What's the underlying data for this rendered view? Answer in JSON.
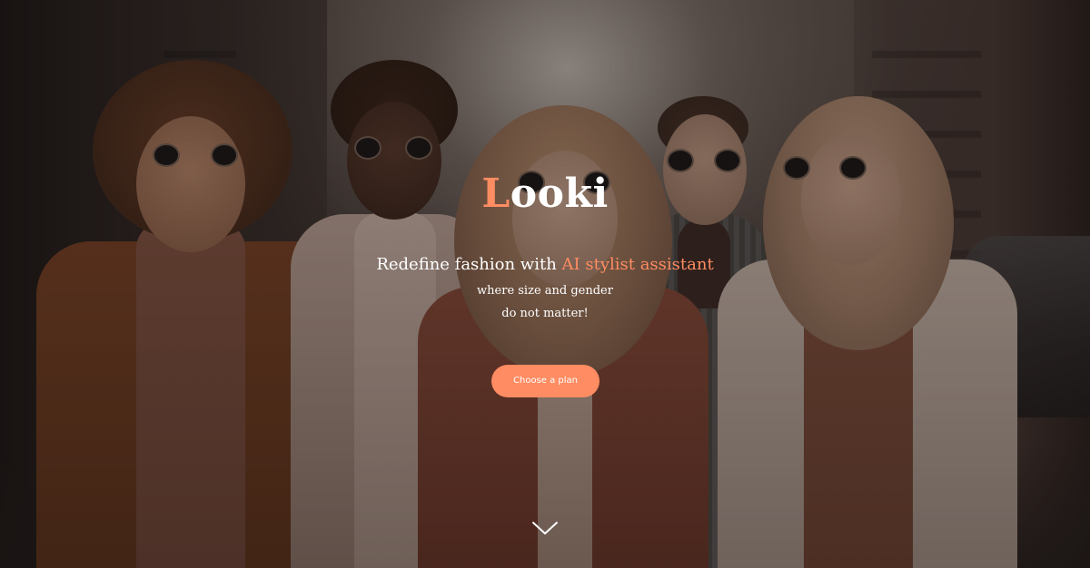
{
  "hero": {
    "logo_first": "L",
    "logo_rest": "ooki",
    "tagline_prefix": "Redefine fashion with ",
    "tagline_highlight": "AI stylist assistant",
    "subline_1": "where size and gender",
    "subline_2": "do not matter!",
    "cta_label": "Choose a plan",
    "scroll_icon": "chevron-down-icon"
  },
  "colors": {
    "accent": "#ff8c62",
    "text": "#ffffff"
  }
}
